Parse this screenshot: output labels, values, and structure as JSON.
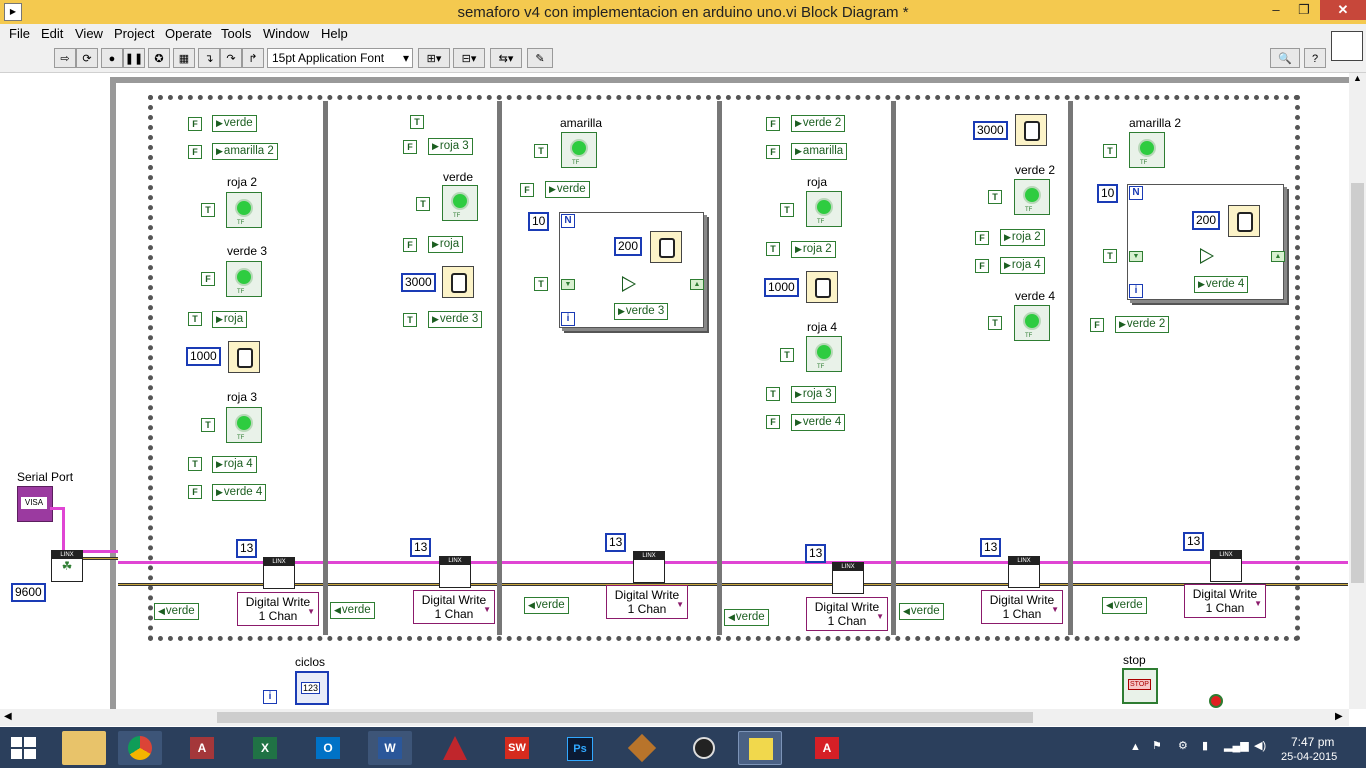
{
  "window": {
    "title": "semaforo v4 con implementacion en arduino uno.vi Block Diagram *",
    "controls": [
      "–",
      "❐",
      "✕"
    ]
  },
  "menu": [
    "File",
    "Edit",
    "View",
    "Project",
    "Operate",
    "Tools",
    "Window",
    "Help"
  ],
  "toolbar": {
    "font": "15pt Application Font",
    "buttons": [
      "run-arrow-icon",
      "run-continuous-icon",
      "abort-icon",
      "pause-icon",
      "highlight-bulb-icon",
      "retain-wire-icon",
      "step-into-icon",
      "step-over-icon",
      "step-out-icon",
      "align-icon",
      "distribute-icon",
      "reorder-icon",
      "cleanup-icon",
      "search-icon",
      "help-icon"
    ]
  },
  "diagram": {
    "serial_port_label": "Serial Port",
    "visa_text": "VISA",
    "baud": "9600",
    "ciclos_label": "ciclos",
    "ciclos_term": "123",
    "stop_label": "stop",
    "stop_text": "STOP",
    "frames": [
      {
        "F1": "verde",
        "F2": "amarilla 2",
        "led1": "roja 2",
        "led2": "verde 3",
        "F3": "roja",
        "wait": "1000",
        "led3": "roja 3",
        "T1": "roja 4",
        "F4": "verde 4",
        "pin": "13",
        "write": "Digital Write\n1 Chan",
        "input": "verde"
      },
      {
        "T1": "roja 3",
        "led1": "verde",
        "F1": "roja",
        "wait": "3000",
        "T2": "verde 3",
        "pin": "13",
        "write": "Digital Write\n1 Chan",
        "input": "verde"
      },
      {
        "led1": "amarilla",
        "F1": "verde",
        "count": "10",
        "ms": "200",
        "out": "verde 3",
        "pin": "13",
        "write": "Digital Write\n1 Chan",
        "input": "verde"
      },
      {
        "F1": "verde 2",
        "F2": "amarilla",
        "led1": "roja",
        "T1": "roja 2",
        "wait": "1000",
        "led2": "roja 4",
        "T2": "roja 3",
        "F3": "verde 4",
        "pin": "13",
        "write": "Digital Write\n1 Chan",
        "input": "verde"
      },
      {
        "wait": "3000",
        "led1": "verde 2",
        "F1": "roja 2",
        "F2": "roja 4",
        "led2": "verde 4",
        "pin": "13",
        "write": "Digital Write\n1 Chan",
        "input": "verde"
      },
      {
        "led1": "amarilla 2",
        "count": "10",
        "ms": "200",
        "out": "verde 4",
        "F1": "verde 2",
        "pin": "13",
        "write": "Digital Write\n1 Chan",
        "input": "verde"
      }
    ],
    "letters": {
      "N": "N",
      "i": "i",
      "T": "T",
      "F": "F"
    }
  },
  "taskbar": {
    "apps": [
      "windows-start-icon",
      "file-explorer-icon",
      "chrome-icon",
      "access-icon",
      "excel-icon",
      "outlook-icon",
      "word-icon",
      "autodesk-icon",
      "solidworks-icon",
      "photoshop-icon",
      "tool-icon",
      "media-icon",
      "labview-icon",
      "acrobat-icon"
    ],
    "time": "7:47 pm",
    "date": "25-04-2015"
  }
}
